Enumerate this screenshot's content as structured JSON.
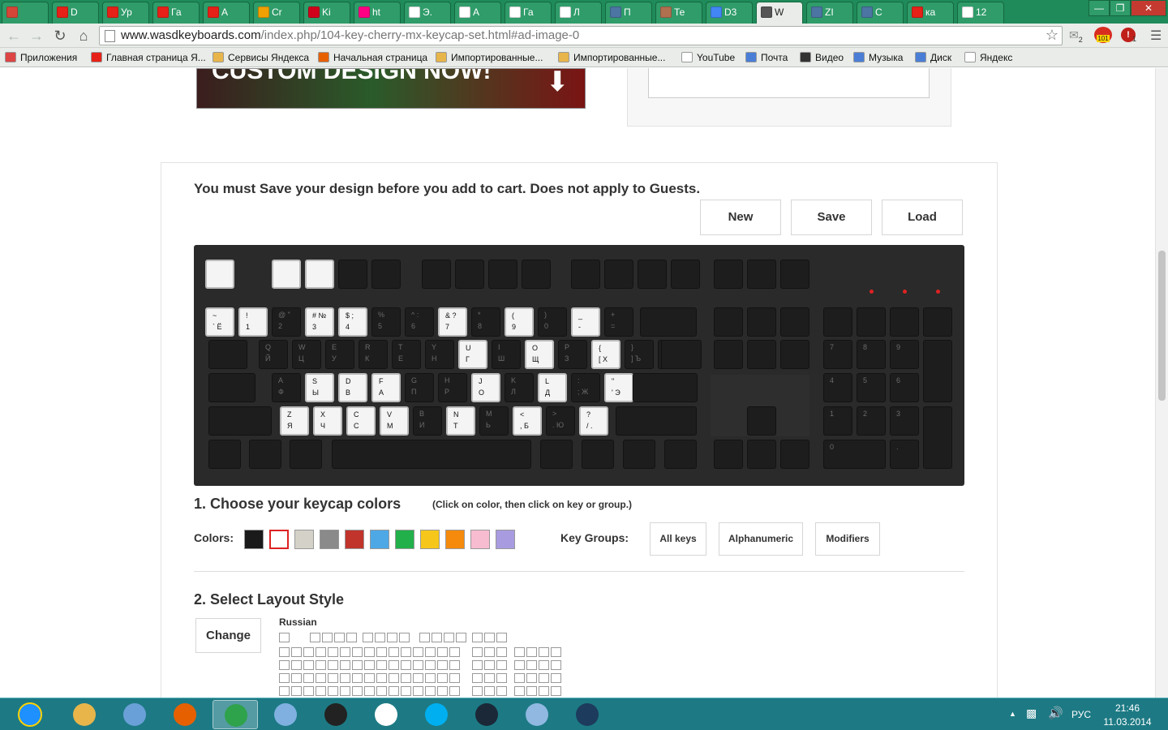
{
  "browser": {
    "tabs": [
      {
        "label": "",
        "icon": "gmail-icon",
        "color": "#d44638"
      },
      {
        "label": "D",
        "icon": "youtube-icon",
        "color": "#e62117"
      },
      {
        "label": "Ур",
        "icon": "youtube-icon",
        "color": "#e62117"
      },
      {
        "label": "Га",
        "icon": "youtube-icon",
        "color": "#e62117"
      },
      {
        "label": "A",
        "icon": "youtube-icon",
        "color": "#e62117"
      },
      {
        "label": "Cr",
        "icon": "lf-icon",
        "color": "#f0a000"
      },
      {
        "label": "Ki",
        "icon": "k-icon",
        "color": "#d0021b"
      },
      {
        "label": "ht",
        "icon": "flickr-icon",
        "color": "#ff0084"
      },
      {
        "label": "Э.",
        "icon": "document-icon",
        "color": "#ffffff"
      },
      {
        "label": "A",
        "icon": "document-icon",
        "color": "#ffffff"
      },
      {
        "label": "Га",
        "icon": "document-icon",
        "color": "#ffffff"
      },
      {
        "label": "Л",
        "icon": "document-icon",
        "color": "#ffffff"
      },
      {
        "label": "П",
        "icon": "vk-icon",
        "color": "#4c75a3"
      },
      {
        "label": "Те",
        "icon": "avatar-icon",
        "color": "#b07050"
      },
      {
        "label": "D3",
        "icon": "google-icon",
        "color": "#4285f4"
      },
      {
        "label": "W",
        "icon": "wasd-icon",
        "color": "#555555"
      },
      {
        "label": "ZI",
        "icon": "vk-icon",
        "color": "#4c75a3"
      },
      {
        "label": "C",
        "icon": "vk-icon",
        "color": "#4c75a3"
      },
      {
        "label": "ка",
        "icon": "yandex-icon",
        "color": "#e62117"
      },
      {
        "label": "12",
        "icon": "image-icon",
        "color": "#ffffff"
      }
    ],
    "active_tab": 15,
    "url_host": "www.wasdkeyboards.com",
    "url_path": "/index.php/104-key-cherry-mx-keycap-set.html#ad-image-0",
    "ext_badge1": "2",
    "ext_badge2": "101",
    "ext_badge3": "1",
    "bookmarks": [
      {
        "label": "Приложения",
        "icon": "apps-icon",
        "color": "#d44"
      },
      {
        "label": "Главная страница Я...",
        "icon": "yandex-icon",
        "color": "#e62117"
      },
      {
        "label": "Сервисы Яндекса",
        "icon": "folder-icon",
        "color": "#e7b54a"
      },
      {
        "label": "Начальная страница",
        "icon": "firefox-icon",
        "color": "#e66000"
      },
      {
        "label": "Импортированные...",
        "icon": "folder-icon",
        "color": "#e7b54a"
      },
      {
        "label": "Импортированные...",
        "icon": "folder-icon",
        "color": "#e7b54a"
      },
      {
        "label": "YouTube",
        "icon": "page-icon",
        "color": "#ffffff"
      },
      {
        "label": "Почта",
        "icon": "mail-icon",
        "color": "#4a7ed6"
      },
      {
        "label": "Видео",
        "icon": "play-icon",
        "color": "#333333"
      },
      {
        "label": "Музыка",
        "icon": "music-icon",
        "color": "#4a7ed6"
      },
      {
        "label": "Диск",
        "icon": "disk-icon",
        "color": "#4a7ed6"
      },
      {
        "label": "Яндекс",
        "icon": "page-icon",
        "color": "#ffffff"
      }
    ]
  },
  "page": {
    "banner_text": "CUSTOM DESIGN NOW!",
    "save_notice": "You must Save your design before you add to cart. Does not apply to Guests.",
    "buttons": {
      "new": "New",
      "save": "Save",
      "load": "Load"
    },
    "section1_title": "1. Choose your keycap colors",
    "section1_hint": "(Click on color, then click on key or group.)",
    "colors_label": "Colors:",
    "colors": [
      "#1a1a1a",
      "#ffffff",
      "#d4d2c8",
      "#8a8a8a",
      "#c0342c",
      "#4ea8e6",
      "#22b04a",
      "#f6c71a",
      "#f58a0c",
      "#f7bcd0",
      "#a89be0"
    ],
    "selected_color": 1,
    "key_groups_label": "Key Groups:",
    "key_groups": [
      "All keys",
      "Alphanumeric",
      "Modifiers"
    ],
    "section2_title": "2. Select Layout Style",
    "change_button": "Change",
    "layout_name": "Russian"
  },
  "keyboard": {
    "rows": [
      [
        {
          "t": "~",
          "b": "` Ё",
          "w": true
        },
        {
          "t": "!",
          "b": "1",
          "w": true
        },
        {
          "t": "@ \"",
          "b": "2",
          "w": false
        },
        {
          "t": "# №",
          "b": "3",
          "w": true
        },
        {
          "t": "$ ;",
          "b": "4",
          "w": true
        },
        {
          "t": "%",
          "b": "5",
          "w": false
        },
        {
          "t": "^ :",
          "b": "6",
          "w": false
        },
        {
          "t": "& ?",
          "b": "7",
          "w": true
        },
        {
          "t": "*",
          "b": "8",
          "w": false
        },
        {
          "t": "(",
          "b": "9",
          "w": true
        },
        {
          "t": ")",
          "b": "0",
          "w": false
        },
        {
          "t": "_",
          "b": "-",
          "w": true
        },
        {
          "t": "+",
          "b": "=",
          "w": false
        }
      ],
      [
        {
          "t": "Q",
          "b": "Й",
          "w": false
        },
        {
          "t": "W",
          "b": "Ц",
          "w": false
        },
        {
          "t": "E",
          "b": "У",
          "w": false
        },
        {
          "t": "R",
          "b": "К",
          "w": false
        },
        {
          "t": "T",
          "b": "Е",
          "w": false
        },
        {
          "t": "Y",
          "b": "Н",
          "w": false
        },
        {
          "t": "U",
          "b": "Г",
          "w": true
        },
        {
          "t": "I",
          "b": "Ш",
          "w": false
        },
        {
          "t": "O",
          "b": "Щ",
          "w": true
        },
        {
          "t": "P",
          "b": "З",
          "w": false
        },
        {
          "t": "{",
          "b": "[ Х",
          "w": true
        },
        {
          "t": "}",
          "b": "] Ъ",
          "w": false
        },
        {
          "t": "| /",
          "b": "\\",
          "w": false
        }
      ],
      [
        {
          "t": "A",
          "b": "Ф",
          "w": false
        },
        {
          "t": "S",
          "b": "Ы",
          "w": true
        },
        {
          "t": "D",
          "b": "В",
          "w": true
        },
        {
          "t": "F",
          "b": "А",
          "w": true
        },
        {
          "t": "G",
          "b": "П",
          "w": false
        },
        {
          "t": "H",
          "b": "Р",
          "w": false
        },
        {
          "t": "J",
          "b": "О",
          "w": true
        },
        {
          "t": "K",
          "b": "Л",
          "w": false
        },
        {
          "t": "L",
          "b": "Д",
          "w": true
        },
        {
          "t": ":",
          "b": "; Ж",
          "w": false
        },
        {
          "t": "\"",
          "b": "' Э",
          "w": true
        }
      ],
      [
        {
          "t": "Z",
          "b": "Я",
          "w": true
        },
        {
          "t": "X",
          "b": "Ч",
          "w": true
        },
        {
          "t": "C",
          "b": "С",
          "w": true
        },
        {
          "t": "V",
          "b": "М",
          "w": true
        },
        {
          "t": "B",
          "b": "И",
          "w": false
        },
        {
          "t": "N",
          "b": "Т",
          "w": true
        },
        {
          "t": "M",
          "b": "Ь",
          "w": false
        },
        {
          "t": "<",
          "b": ", Б",
          "w": true
        },
        {
          "t": ">",
          "b": ". Ю",
          "w": false
        },
        {
          "t": "?",
          "b": "/ .",
          "w": true
        }
      ]
    ],
    "numpad": [
      [
        "7",
        "8",
        "9"
      ],
      [
        "4",
        "5",
        "6"
      ],
      [
        "1",
        "2",
        "3"
      ]
    ],
    "numpad_zero": "0",
    "numpad_dot": "."
  },
  "taskbar": {
    "apps": [
      {
        "name": "ie-icon",
        "color": "#1e90ff"
      },
      {
        "name": "explorer-icon",
        "color": "#e7b54a"
      },
      {
        "name": "notepad-icon",
        "color": "#6aa0d8"
      },
      {
        "name": "firefox-icon",
        "color": "#e66000"
      },
      {
        "name": "chrome-icon",
        "color": "#2fa24c"
      },
      {
        "name": "paint-icon",
        "color": "#7fb0e0"
      },
      {
        "name": "obs-icon",
        "color": "#222222"
      },
      {
        "name": "apps-grid-icon",
        "color": "#ffffff"
      },
      {
        "name": "skype-icon",
        "color": "#00aff0"
      },
      {
        "name": "steam-icon",
        "color": "#1b2838"
      },
      {
        "name": "calculator-icon",
        "color": "#90b8e0"
      },
      {
        "name": "dota-icon",
        "color": "#1d3b5c"
      }
    ],
    "active_app": 4,
    "lang": "РУС",
    "time": "21:46",
    "date": "11.03.2014"
  }
}
